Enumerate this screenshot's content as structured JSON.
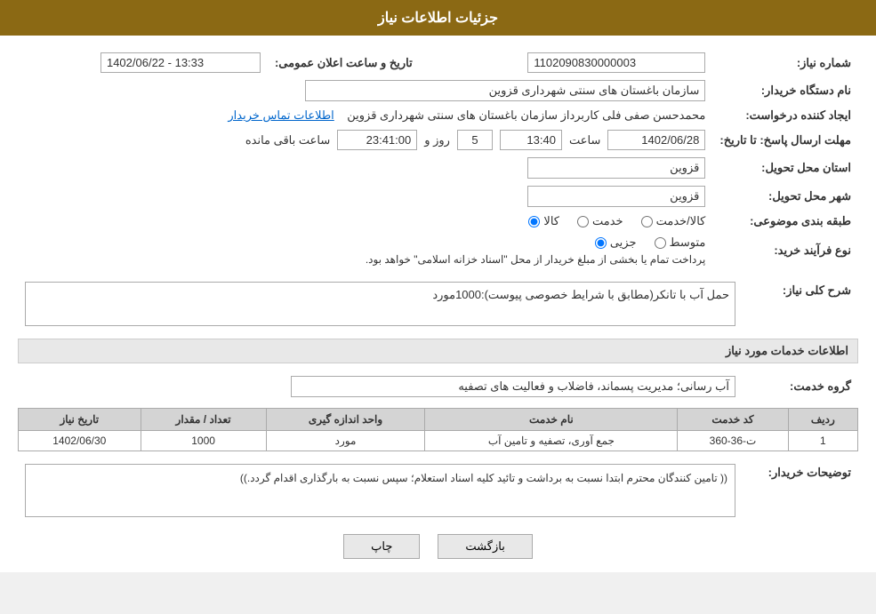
{
  "header": {
    "title": "جزئیات اطلاعات نیاز"
  },
  "fields": {
    "need_number_label": "شماره نیاز:",
    "need_number_value": "1102090830000003",
    "announce_date_label": "تاریخ و ساعت اعلان عمومی:",
    "announce_date_value": "1402/06/22 - 13:33",
    "buyer_org_label": "نام دستگاه خریدار:",
    "buyer_org_value": "سازمان باغستان های سنتی شهرداری قزوین",
    "requester_label": "ایجاد کننده درخواست:",
    "requester_value": "محمدحسن صفی فلی کاربرداز سازمان باغستان های سنتی شهرداری قزوین",
    "contact_link": "اطلاعات تماس خریدار",
    "deadline_label": "مهلت ارسال پاسخ: تا تاریخ:",
    "deadline_date": "1402/06/28",
    "deadline_time": "13:40",
    "deadline_days": "5",
    "deadline_remaining": "23:41:00",
    "deadline_days_label": "روز و",
    "deadline_remaining_label": "ساعت باقی مانده",
    "province_label": "استان محل تحویل:",
    "province_value": "قزوین",
    "city_label": "شهر محل تحویل:",
    "city_value": "قزوین",
    "category_label": "طبقه بندی موضوعی:",
    "category_kala": "کالا",
    "category_khedmat": "خدمت",
    "category_kala_khedmat": "کالا/خدمت",
    "category_selected": "کالا",
    "purchase_type_label": "نوع فرآیند خرید:",
    "purchase_partial": "جزیی",
    "purchase_medium": "متوسط",
    "purchase_note": "پرداخت تمام یا بخشی از مبلغ خریدار از محل \"اسناد خزانه اسلامی\" خواهد بود.",
    "need_desc_label": "شرح کلی نیاز:",
    "need_desc_value": "حمل آب با تانکر(مطابق با شرایط خصوصی پیوست):1000مورد",
    "services_section_label": "اطلاعات خدمات مورد نیاز",
    "service_group_label": "گروه خدمت:",
    "service_group_value": "آب رسانی؛ مدیریت پسماند، فاضلاب و فعالیت های تصفیه"
  },
  "services_table": {
    "headers": [
      "ردیف",
      "کد خدمت",
      "نام خدمت",
      "واحد اندازه گیری",
      "تعداد / مقدار",
      "تاریخ نیاز"
    ],
    "rows": [
      {
        "row_num": "1",
        "service_code": "ت-36-360",
        "service_name": "جمع آوری، تصفیه و تامین آب",
        "unit": "مورد",
        "quantity": "1000",
        "date": "1402/06/30"
      }
    ]
  },
  "buyer_notes_label": "توضیحات خریدار:",
  "buyer_notes_value": "(( تامین کنندگان محترم ابتدا نسبت به برداشت و تائید کلیه اسناد استعلام؛ سپس نسبت به بارگذاری اقدام گردد.))",
  "buttons": {
    "print": "چاپ",
    "back": "بازگشت"
  }
}
